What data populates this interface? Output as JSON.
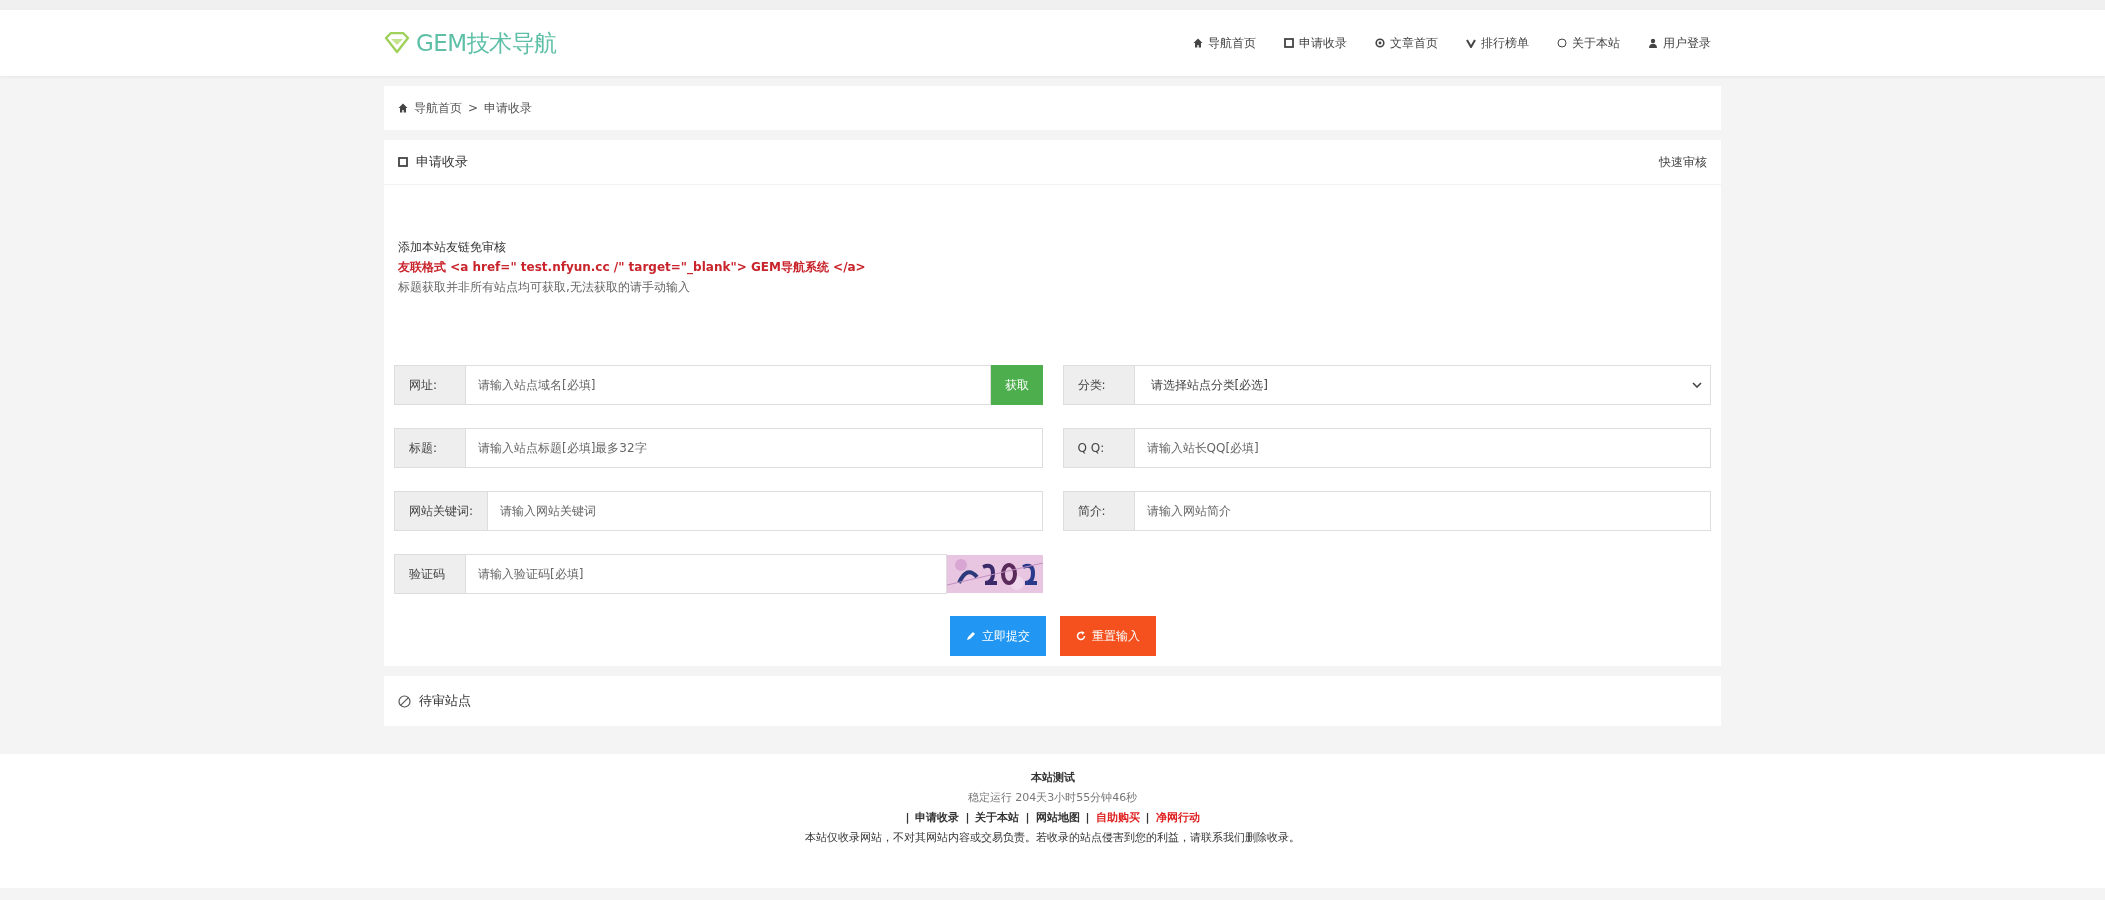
{
  "header": {
    "logo": "GEM技术导航",
    "nav": [
      {
        "label": "导航首页"
      },
      {
        "label": "申请收录"
      },
      {
        "label": "文章首页"
      },
      {
        "label": "排行榜单"
      },
      {
        "label": "关于本站"
      },
      {
        "label": "用户登录"
      }
    ]
  },
  "breadcrumb": {
    "items": [
      "导航首页",
      "申请收录"
    ],
    "separator": ">"
  },
  "apply_card": {
    "title": "申请收录",
    "action": "快速审核",
    "notes": [
      {
        "kind": "plain",
        "text": "添加本站友链免审核"
      },
      {
        "kind": "code",
        "text": "友联格式 <a href=\" test.nfyun.cc /\" target=\"_blank\"> GEM导航系统 </a>"
      },
      {
        "kind": "hint",
        "text": "标题获取并非所有站点均可获取,无法获取的请手动输入"
      }
    ],
    "fields": [
      {
        "kind": "fetch",
        "label": "网址:",
        "placeholder": "请输入站点域名[必填]",
        "button": "获取"
      },
      {
        "kind": "select",
        "label": "分类:",
        "placeholder": "请选择站点分类[必选]"
      },
      {
        "kind": "text",
        "label": "标题:",
        "placeholder": "请输入站点标题[必填]最多32字"
      },
      {
        "kind": "text",
        "label": "Q Q:",
        "placeholder": "请输入站长QQ[必填]"
      },
      {
        "kind": "text",
        "label": "网站关键词:",
        "placeholder": "请输入网站关键词"
      },
      {
        "kind": "text",
        "label": "简介:",
        "placeholder": "请输入网站简介"
      },
      {
        "kind": "captcha",
        "label": "验证码",
        "placeholder": "请输入验证码[必填]"
      }
    ],
    "buttons": [
      {
        "kind": "submit",
        "label": "立即提交"
      },
      {
        "kind": "reset",
        "label": "重置输入"
      }
    ]
  },
  "pending": {
    "title": "待审站点"
  },
  "footer": {
    "name": "本站测试",
    "uptime": "稳定运行 204天3小时55分钟46秒",
    "separator": "|",
    "links": [
      {
        "label": "申请收录",
        "color": "#333333"
      },
      {
        "label": "关于本站",
        "color": "#333333"
      },
      {
        "label": "网站地图",
        "color": "#333333"
      },
      {
        "label": "自助购买",
        "color": "#e02020"
      },
      {
        "label": "净网行动",
        "color": "#e02020"
      }
    ],
    "disclaimer": "本站仅收录网站，不对其网站内容或交易负责。若收录的站点侵害到您的利益，请联系我们删除收录。"
  }
}
